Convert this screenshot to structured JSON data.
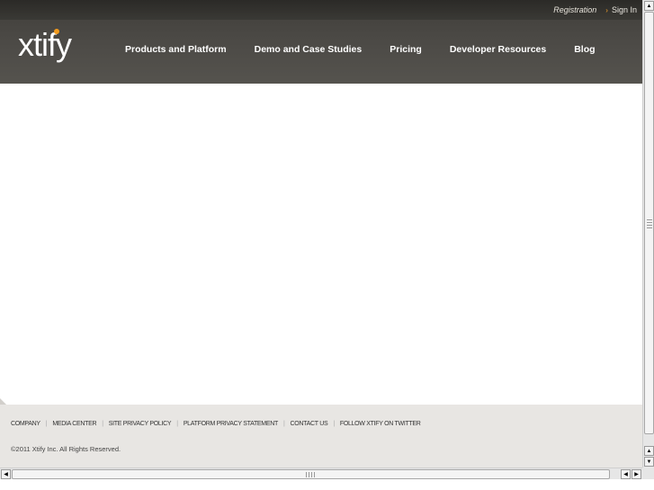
{
  "header": {
    "utility": {
      "registration": "Registration",
      "sign_in": "Sign In"
    },
    "logo": {
      "text": "xtify"
    },
    "nav": [
      {
        "label": "Products and Platform"
      },
      {
        "label": "Demo and Case Studies"
      },
      {
        "label": "Pricing"
      },
      {
        "label": "Developer Resources"
      },
      {
        "label": "Blog"
      }
    ]
  },
  "footer": {
    "links": [
      {
        "label": "COMPANY"
      },
      {
        "label": "MEDIA CENTER"
      },
      {
        "label": "SITE PRIVACY POLICY"
      },
      {
        "label": "PLATFORM PRIVACY STATEMENT"
      },
      {
        "label": "CONTACT US"
      },
      {
        "label": "FOLLOW XTIFY ON TWITTER"
      }
    ],
    "copyright": "©2011 Xtify Inc. All Rights Reserved."
  },
  "colors": {
    "header_bg": "#4b4945",
    "accent": "#f39b1d",
    "footer_bg": "#e8e6e3"
  },
  "icons": {
    "sign_in_arrow": "chevron-right-icon"
  }
}
